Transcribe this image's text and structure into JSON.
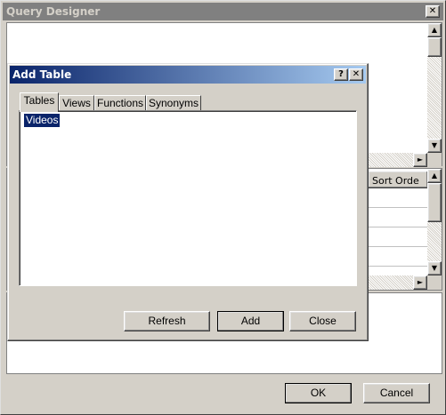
{
  "main_window": {
    "title": "Query Designer",
    "close_glyph": "✕",
    "grid_column_header": "Sort Orde",
    "ok_label": "OK",
    "cancel_label": "Cancel"
  },
  "add_table_dialog": {
    "title": "Add Table",
    "help_glyph": "?",
    "close_glyph": "✕",
    "tabs": [
      {
        "label": "Tables"
      },
      {
        "label": "Views"
      },
      {
        "label": "Functions"
      },
      {
        "label": "Synonyms"
      }
    ],
    "selected_tab": "Tables",
    "list_items": [
      "Videos"
    ],
    "buttons": {
      "refresh": "Refresh",
      "add": "Add",
      "close": "Close"
    }
  },
  "icons": {
    "scroll_up": "▲",
    "scroll_down": "▼",
    "scroll_right": "►"
  },
  "colors": {
    "title_active_start": "#0a246a",
    "title_active_end": "#a6caf0",
    "title_inactive": "#808080",
    "face": "#d4d0c8",
    "selection": "#0a246a"
  }
}
